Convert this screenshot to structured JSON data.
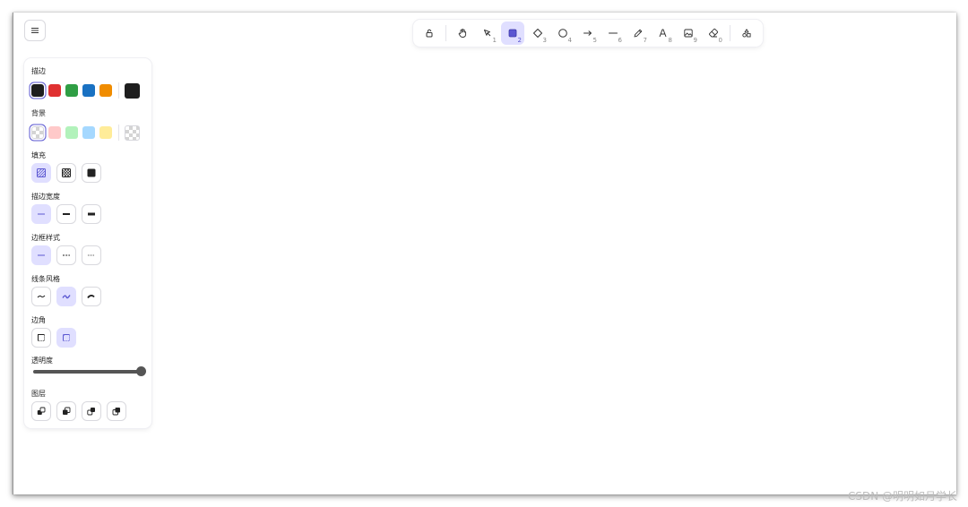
{
  "panel": {
    "stroke_label": "描边",
    "background_label": "背景",
    "fill_label": "填充",
    "stroke_width_label": "描边宽度",
    "stroke_style_label": "边框样式",
    "sloppiness_label": "线条风格",
    "edges_label": "边角",
    "opacity_label": "透明度",
    "layers_label": "图层",
    "opacity_value": 100
  },
  "stroke_colors": [
    "#1e1e1e",
    "#e03131",
    "#2f9e44",
    "#1971c2",
    "#f08c00"
  ],
  "stroke_current": "#1e1e1e",
  "background_colors": [
    "transparent",
    "#ffc9c9",
    "#b2f2bb",
    "#a5d8ff",
    "#ffec99"
  ],
  "accent": "#5b57d1",
  "toolbar": {
    "tools": [
      {
        "icon": "lock-icon",
        "num": ""
      },
      {
        "icon": "hand-icon",
        "num": ""
      },
      {
        "icon": "selection-icon",
        "num": "1"
      },
      {
        "icon": "rectangle-icon",
        "num": "2",
        "active": true
      },
      {
        "icon": "diamond-icon",
        "num": "3"
      },
      {
        "icon": "ellipse-icon",
        "num": "4"
      },
      {
        "icon": "arrow-icon",
        "num": "5"
      },
      {
        "icon": "line-icon",
        "num": "6"
      },
      {
        "icon": "pencil-icon",
        "num": "7"
      },
      {
        "icon": "text-icon",
        "num": "8"
      },
      {
        "icon": "image-icon",
        "num": "9"
      },
      {
        "icon": "eraser-icon",
        "num": "0"
      },
      {
        "icon": "shapes-library-icon",
        "num": ""
      }
    ]
  },
  "watermark": "CSDN @明明如月学长"
}
